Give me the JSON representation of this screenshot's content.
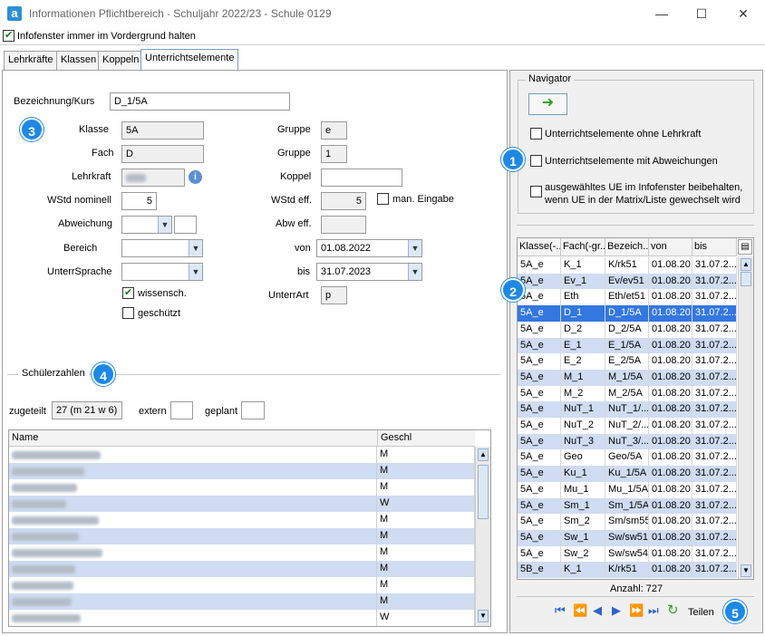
{
  "window": {
    "title": "Informationen Pflichtbereich - Schuljahr 2022/23 - Schule 0129",
    "app_icon": "a"
  },
  "keep_front": {
    "label": "Infofenster immer im Vordergrund halten",
    "checked": true
  },
  "tabs": [
    {
      "label": "Lehrkräfte"
    },
    {
      "label": "Klassen"
    },
    {
      "label": "Koppeln"
    },
    {
      "label": "Unterrichtselemente",
      "active": true
    }
  ],
  "form": {
    "kurs_label": "Bezeichnung/Kurs",
    "kurs_value": "D_1/5A",
    "klasse_label": "Klasse",
    "klasse_value": "5A",
    "fach_label": "Fach",
    "fach_value": "D",
    "lehrkraft_label": "Lehrkraft",
    "wstd_nominell_label": "WStd nominell",
    "wstd_nominell_value": "5",
    "abweichung_label": "Abweichung",
    "bereich_label": "Bereich",
    "unterrsprache_label": "UnterrSprache",
    "wissensch_label": "wissensch.",
    "wissensch_checked": true,
    "geschuetzt_label": "geschützt",
    "geschuetzt_checked": false,
    "gruppe1_label": "Gruppe",
    "gruppe1_value": "e",
    "gruppe2_label": "Gruppe",
    "gruppe2_value": "1",
    "koppel_label": "Koppel",
    "wstd_eff_label": "WStd eff.",
    "wstd_eff_value": "5",
    "man_eingabe_label": "man. Eingabe",
    "abw_eff_label": "Abw eff.",
    "von_label": "von",
    "von_value": "01.08.2022",
    "bis_label": "bis",
    "bis_value": "31.07.2023",
    "unterrart_label": "UnterrArt",
    "unterrart_value": "p"
  },
  "schueler": {
    "section_label": "Schülerzahlen",
    "zugeteilt_label": "zugeteilt",
    "zugeteilt_value": "27 (m 21 w 6)",
    "extern_label": "extern",
    "geplant_label": "geplant",
    "col_name": "Name",
    "col_geschl": "Geschl",
    "rows": [
      "M",
      "M",
      "M",
      "W",
      "M",
      "M",
      "M",
      "M",
      "M",
      "M",
      "W"
    ]
  },
  "navigator": {
    "title": "Navigator",
    "opt_ohne_lehrkraft": "Unterrichtselemente ohne Lehrkraft",
    "opt_abweichungen": "Unterrichtselemente mit Abweichungen",
    "opt_beibehalten_1": "ausgewähltes UE im Infofenster beibehalten,",
    "opt_beibehalten_2": "wenn UE in der Matrix/Liste gewechselt wird",
    "columns": [
      "Klasse(-...",
      "Fach(-gr...",
      "Bezeich...",
      "von",
      "bis"
    ],
    "rows": [
      [
        "5A_e",
        "K_1",
        "K/rk51",
        "01.08.20...",
        "31.07.2..."
      ],
      [
        "5A_e",
        "Ev_1",
        "Ev/ev51",
        "01.08.20...",
        "31.07.2..."
      ],
      [
        "5A_e",
        "Eth",
        "Eth/et51",
        "01.08.20...",
        "31.07.2..."
      ],
      [
        "5A_e",
        "D_1",
        "D_1/5A",
        "01.08.20...",
        "31.07.2..."
      ],
      [
        "5A_e",
        "D_2",
        "D_2/5A",
        "01.08.20...",
        "31.07.2..."
      ],
      [
        "5A_e",
        "E_1",
        "E_1/5A",
        "01.08.20...",
        "31.07.2..."
      ],
      [
        "5A_e",
        "E_2",
        "E_2/5A",
        "01.08.20...",
        "31.07.2..."
      ],
      [
        "5A_e",
        "M_1",
        "M_1/5A",
        "01.08.20...",
        "31.07.2..."
      ],
      [
        "5A_e",
        "M_2",
        "M_2/5A",
        "01.08.20...",
        "31.07.2..."
      ],
      [
        "5A_e",
        "NuT_1",
        "NuT_1/...",
        "01.08.20...",
        "31.07.2..."
      ],
      [
        "5A_e",
        "NuT_2",
        "NuT_2/...",
        "01.08.20...",
        "31.07.2..."
      ],
      [
        "5A_e",
        "NuT_3",
        "NuT_3/...",
        "01.08.20...",
        "31.07.2..."
      ],
      [
        "5A_e",
        "Geo",
        "Geo/5A",
        "01.08.20...",
        "31.07.2..."
      ],
      [
        "5A_e",
        "Ku_1",
        "Ku_1/5A",
        "01.08.20...",
        "31.07.2..."
      ],
      [
        "5A_e",
        "Mu_1",
        "Mu_1/5A",
        "01.08.20...",
        "31.07.2..."
      ],
      [
        "5A_e",
        "Sm_1",
        "Sm_1/5A",
        "01.08.20...",
        "31.07.2..."
      ],
      [
        "5A_e",
        "Sm_2",
        "Sm/sm55",
        "01.08.20...",
        "31.07.2..."
      ],
      [
        "5A_e",
        "Sw_1",
        "Sw/sw51",
        "01.08.20...",
        "31.07.2..."
      ],
      [
        "5A_e",
        "Sw_2",
        "Sw/sw54",
        "01.08.20...",
        "31.07.2..."
      ],
      [
        "5B_e",
        "K_1",
        "K/rk51",
        "01.08.20...",
        "31.07.2..."
      ]
    ],
    "selected_row": 3,
    "anzahl": "Anzahl: 727",
    "teilen_label": "Teilen"
  },
  "badges": [
    "1",
    "2",
    "3",
    "4",
    "5"
  ],
  "colors": {
    "accent": "#1e88e5",
    "selected_row": "#3377e0",
    "alt_row": "#cfdcf2"
  }
}
